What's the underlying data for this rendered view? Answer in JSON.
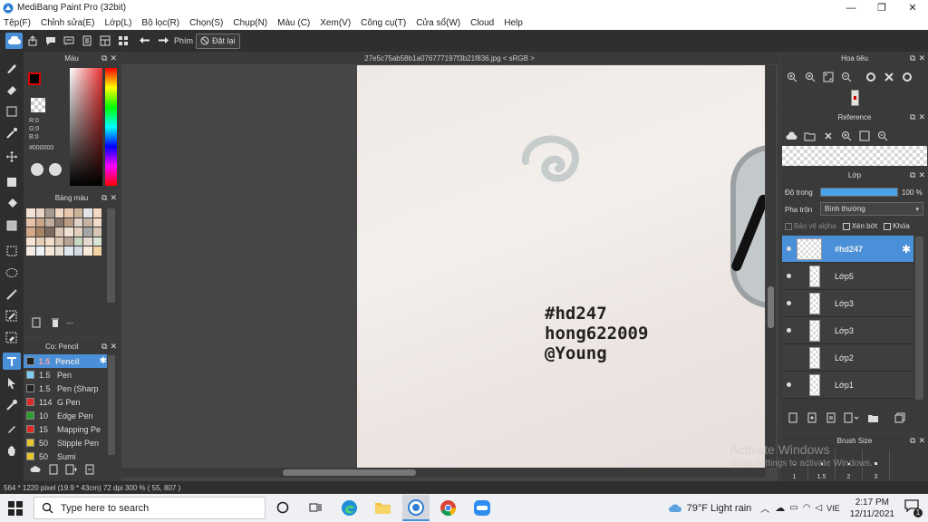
{
  "window": {
    "title": "MediBang Paint Pro (32bit)",
    "min": "—",
    "max": "❐",
    "close": "✕"
  },
  "menu": [
    "Tệp(F)",
    "Chỉnh sửa(E)",
    "Lớp(L)",
    "Bộ lọc(R)",
    "Chọn(S)",
    "Chụp(N)",
    "Màu (C)",
    "Xem(V)",
    "Công cụ(T)",
    "Cửa sổ(W)",
    "Cloud",
    "Help"
  ],
  "toolbar": {
    "shortcut_label": "Phím",
    "reset_label": "Đặt lại"
  },
  "color_panel": {
    "title": "Màu",
    "r": "R:0",
    "g": "G:0",
    "b": "B:0",
    "hex": "#000000"
  },
  "swatch_panel": {
    "title": "Bảng màu",
    "footer_text": "---",
    "swatches": [
      "#f1e2d5",
      "#e8d6c8",
      "#a99a8f",
      "#efd7c1",
      "#e7c8ae",
      "#cdb29a",
      "#e3e3e3",
      "#f5d8c2",
      "#e6c3a8",
      "#c9a68a",
      "#bfae9f",
      "#8a7a6e",
      "#b89c84",
      "#dcd2c7",
      "#c6b4a2",
      "#f2dbc7",
      "#d4a88a",
      "#a68567",
      "#7b6a5e",
      "#d9c4b1",
      "#efe1d0",
      "#e2cfbd",
      "#a5a5a5",
      "#d8c7b6",
      "#f7e5d3",
      "#e5cfb7",
      "#f1ddc9",
      "#dcc5b0",
      "#b6a292",
      "#c7d7c0",
      "#e5d9cf",
      "#d9e6d4",
      "#f4ece4",
      "#eef2f6",
      "#f5e6d8",
      "#eadfd4",
      "#e1e8ee",
      "#d2dbe3",
      "#f9e9da",
      "#f3d2a4"
    ]
  },
  "brush_panel": {
    "title": "Cọ: Pencil",
    "items": [
      {
        "size": "1.5",
        "name": "Pencil",
        "color": "#222222"
      },
      {
        "size": "1.5",
        "name": "Pen",
        "color": "#7ecbf5"
      },
      {
        "size": "1.5",
        "name": "Pen (Sharp",
        "color": "#222222"
      },
      {
        "size": "114",
        "name": "G Pen",
        "color": "#e02a2a"
      },
      {
        "size": "10",
        "name": "Edge Pen",
        "color": "#2aa02a"
      },
      {
        "size": "15",
        "name": "Mapping Pe",
        "color": "#e02a2a"
      },
      {
        "size": "50",
        "name": "Stipple Pen",
        "color": "#e8c52a"
      },
      {
        "size": "50",
        "name": "Sumi",
        "color": "#e8c52a"
      }
    ]
  },
  "document": {
    "tab_title": "27e5c75ab58b1a076777197f3b21f836.jpg < sRGB >",
    "text_lines": [
      "#hd247",
      "hong622009",
      "@Young"
    ]
  },
  "navigator": {
    "title": "Hoa tiêu"
  },
  "reference": {
    "title": "Reference"
  },
  "layer_panel": {
    "title": "Lớp",
    "opacity_label": "Độ trong",
    "opacity_value": "100 %",
    "opacity_fraction": 1.0,
    "blend_label": "Pha trộn",
    "blend_value": "Bình thường",
    "alpha_protect": "Bảo vệ alpha",
    "clipping": "Xén bớt",
    "lock": "Khóa",
    "layers": [
      {
        "name": "#hd247",
        "selected": true,
        "visible": true
      },
      {
        "name": "Lớp5",
        "selected": false,
        "visible": true
      },
      {
        "name": "Lớp3",
        "selected": false,
        "visible": true
      },
      {
        "name": "Lớp3",
        "selected": false,
        "visible": true
      },
      {
        "name": "Lớp2",
        "selected": false,
        "visible": false
      },
      {
        "name": "Lớp1",
        "selected": false,
        "visible": true
      }
    ]
  },
  "brush_size": {
    "title": "Brush Size",
    "values": [
      "1",
      "1.5",
      "2",
      "3"
    ]
  },
  "status": {
    "text": "564 * 1220 pixel  (19.9 * 43cm)  72 dpi  300 %  ( 55, 807 )"
  },
  "watermark": {
    "line1": "Activate Windows",
    "line2": "Go to Settings to activate Windows."
  },
  "taskbar": {
    "search_placeholder": "Type here to search",
    "weather": "79°F  Light rain",
    "lang": "VIE",
    "time": "2:17 PM",
    "date": "12/11/2021",
    "notif_count": "1"
  },
  "colors": {
    "accent": "#4a90d9",
    "panel": "#3a3a3a",
    "dark": "#2e2e2e"
  }
}
